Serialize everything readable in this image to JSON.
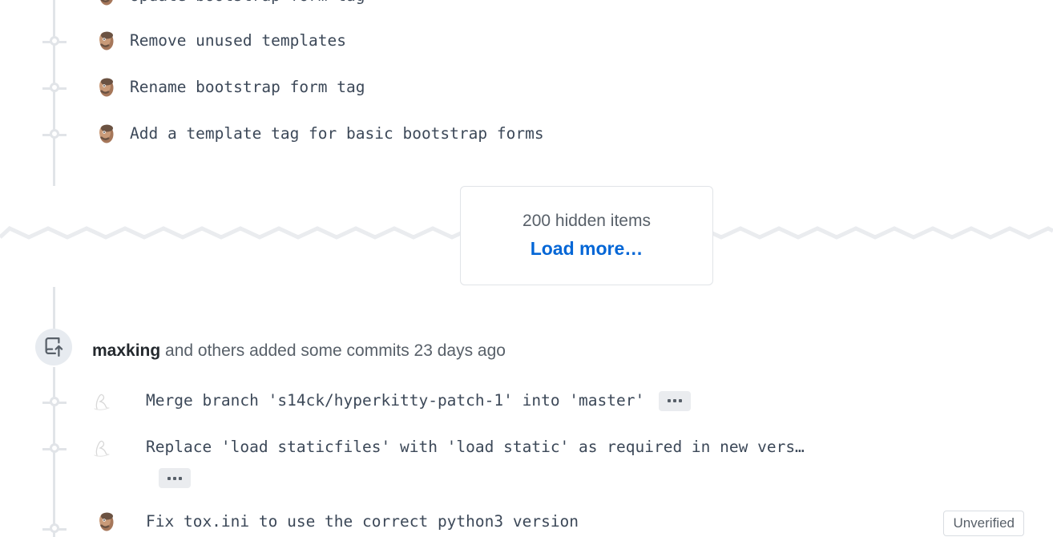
{
  "timeline": {
    "clipped_top_row": {
      "message": "Update bootstrap form tag",
      "avatar_icon": "user-photo-avatar"
    },
    "commits_before": [
      {
        "message": "Remove unused templates",
        "avatar_icon": "user-photo-avatar"
      },
      {
        "message": "Rename bootstrap form tag",
        "avatar_icon": "user-photo-avatar"
      },
      {
        "message": "Add a template tag for basic bootstrap forms",
        "avatar_icon": "user-photo-avatar"
      }
    ],
    "hidden_items": {
      "count_label": "200 hidden items",
      "load_more_label": "Load more…",
      "link_color": "#0366d6"
    },
    "event": {
      "icon": "repo-push-icon",
      "actor": "maxking",
      "rest": " and others added some commits 23 days ago"
    },
    "commits_after": [
      {
        "message": "Merge branch 's14ck/hyperkitty-patch-1' into 'master'",
        "avatar_icon": "script-monogram-avatar",
        "has_expander": true,
        "expander_label": "…"
      },
      {
        "message": "Replace 'load staticfiles' with 'load static' as required in new vers…",
        "avatar_icon": "script-monogram-avatar",
        "has_expander": true,
        "expander_label": "…"
      },
      {
        "message": "Fix tox.ini to use the correct python3 version",
        "avatar_icon": "user-photo-avatar",
        "has_expander": false,
        "badge": "Unverified"
      }
    ]
  },
  "colors": {
    "rail": "#e1e4e8",
    "text": "#3c4858",
    "muted": "#586069",
    "link": "#0366d6",
    "badge_bg": "#eaecef"
  }
}
